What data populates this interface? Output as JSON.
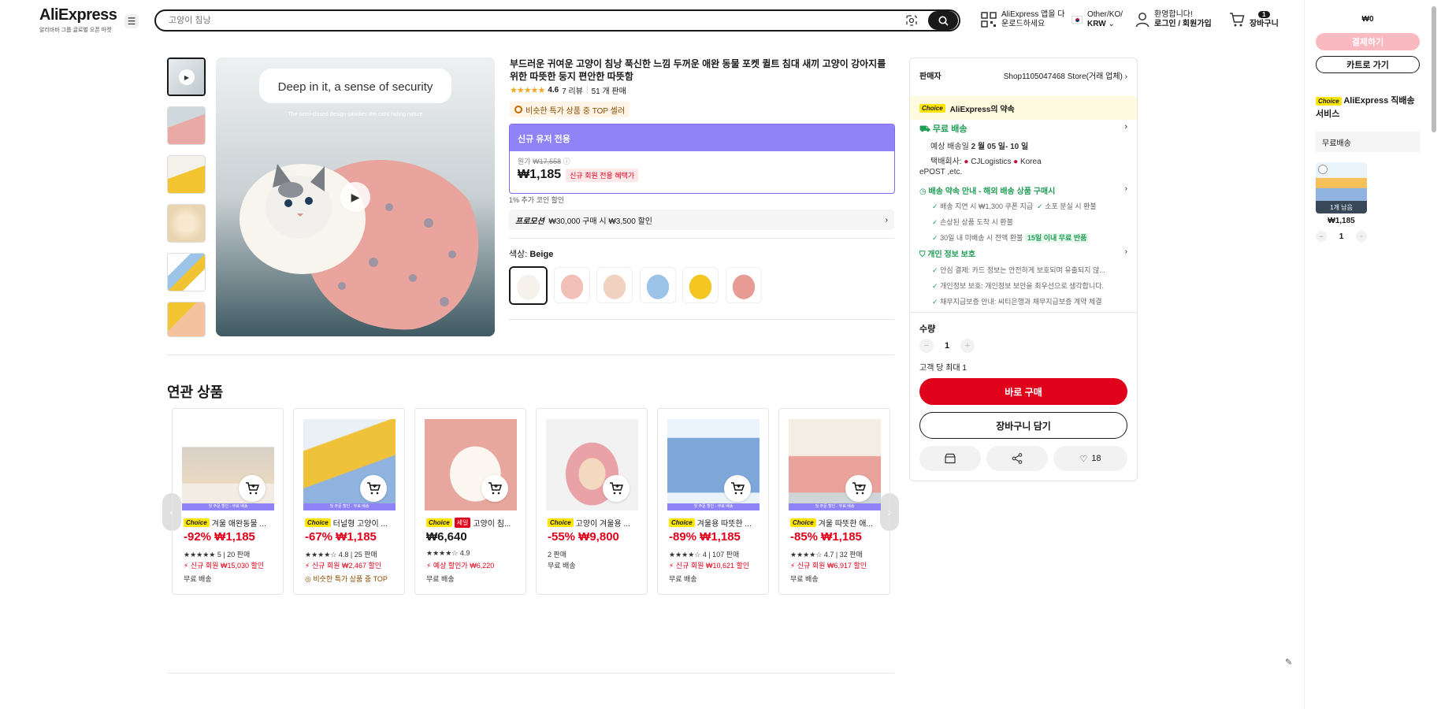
{
  "header": {
    "logo": "AliExpress",
    "logo_sub": "알리바바 그룹 글로벌 오픈 마켓",
    "search_placeholder": "고양이 침낭",
    "app_line1": "AliExpress 앱을 다",
    "app_line2": "운로드하세요",
    "locale_line1": "Other/KO/",
    "locale_line2": "KRW",
    "welcome_line1": "환영합니다!",
    "welcome_line2": "로그인 / 회원가입",
    "cart_count": "1",
    "cart_label": "장바구니"
  },
  "product": {
    "main_image_text": "Deep in it, a sense of security",
    "main_image_sub": "The semi-closed design satisfies the cat's hiding nature",
    "title": "부드러운 귀여운 고양이 침낭 푹신한 느낌 두꺼운 애완 동물 포켓 퀼트 침대 새끼 고양이 강아지를위한 따뜻한 둥지 편안한 따뜻함",
    "rating": "4.6",
    "reviews": "7 리뷰",
    "sold": "51 개 판매",
    "top_badge": "비슷한 특가 상품 중 TOP 셀러",
    "newuser_header": "신규 유저 전용",
    "original_label": "원가",
    "original_price": "₩17,558",
    "price": "₩1,185",
    "newuser_tag": "신규 회원 전용 혜택가",
    "coin_note": "1% 추가 코인 할인",
    "promo_label": "프로모션",
    "promo_text": "₩30,000 구매 시 ₩3,500 할인",
    "color_label": "색상:",
    "color_value": "Beige"
  },
  "buy": {
    "seller_label": "판매자",
    "seller_name": "Shop1105047468 Store(거래 업체)",
    "choice_badge": "Choice",
    "choice_promise": "AliExpress의 약속",
    "free_ship": "무료 배송",
    "delivery_prefix": "예상 배송일",
    "delivery_date": "2 월 05 일- 10 일",
    "courier_label": "택배회사:",
    "courier_1": "CJLogistics",
    "courier_2": "Korea",
    "courier_3": "ePOST ,etc.",
    "promise_title": "배송 약속 안내 - 해외 배송 상품 구매시",
    "promise_1": "배송 지연 시 ₩1,300 쿠폰 지급",
    "promise_2": "소포 분실 시 환불",
    "promise_3": "손상된 상품 도착 시 환불",
    "promise_4": "30일 내 미배송 시 전액 환불",
    "promise_4_tag": "15일 이내 무료 반품",
    "privacy_title": "개인 정보 보호",
    "privacy_1": "안심 결제: 카드 정보는 안전하게 보호되며 유출되지 않...",
    "privacy_2": "개인정보 보호: 개인정보 보안을 최우선으로 생각합니다.",
    "privacy_3": "채무지급보증 안내: 씨티은행과 채무지급보증 계약 체결",
    "qty_label": "수량",
    "qty": "1",
    "max_note": "고객 당 최대 1",
    "buy_now": "바로 구매",
    "add_cart": "장바구니 담기",
    "wish_count": "18"
  },
  "related": {
    "title": "연관 상품",
    "strip_text": "첫 주문 할인 · 무료 배송",
    "items": [
      {
        "tag": "Choice",
        "name": "겨울 애완동물 ...",
        "price": "-92% ₩1,185",
        "meta": "★★★★★ 5 | 20 판매",
        "promo": "신규 회원 ₩15,030 할인",
        "ship": "무료 배송"
      },
      {
        "tag": "Choice",
        "name": "터널형 고양이 ...",
        "price": "-67% ₩1,185",
        "meta": "★★★★☆ 4.8 | 25 판매",
        "promo": "신규 회원 ₩2,467 할인",
        "promo2": "비슷한 특가 상품 중 TOP",
        "ship": ""
      },
      {
        "tag": "Choice",
        "tag2": "세일",
        "name": "고양이 침...",
        "price": "₩6,640",
        "meta": "★★★★☆ 4.9",
        "promo": "예상 할인가 ₩6,220",
        "ship": "무료 배송"
      },
      {
        "tag": "Choice",
        "name": "고양이 겨울용 ...",
        "price": "-55% ₩9,800",
        "meta": "2 판매",
        "promo": "",
        "ship": "무료 배송"
      },
      {
        "tag": "Choice",
        "name": "겨울용 따뜻한 ...",
        "price": "-89% ₩1,185",
        "meta": "★★★★☆ 4 | 107 판매",
        "promo": "신규 회원 ₩10,621 할인",
        "ship": "무료 배송"
      },
      {
        "tag": "Choice",
        "name": "겨울 따뜻한 애...",
        "price": "-85% ₩1,185",
        "meta": "★★★★☆ 4.7 | 32 판매",
        "promo": "신규 회원 ₩6,917 할인",
        "ship": "무료 배송"
      }
    ]
  },
  "sidecart": {
    "total": "₩0",
    "checkout": "결제하기",
    "goto_cart": "카트로 가기",
    "choice_badge": "Choice",
    "choice_title": "AliExpress 직배송 서비스",
    "free_ship": "무료배송",
    "item_left": "1개 남음",
    "item_price": "₩1,185",
    "item_qty": "1"
  },
  "colors": {
    "accent_red": "#e0021a",
    "choice_yellow": "#ffe600",
    "newuser_purple": "#8f83f7",
    "green": "#1f9d55"
  }
}
